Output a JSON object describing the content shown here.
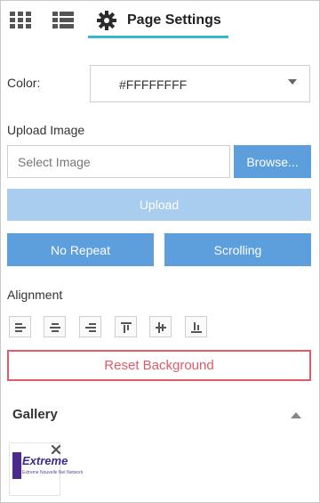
{
  "tabs": {
    "grid_icon": "grid-icon",
    "list_icon": "list-icon",
    "settings": {
      "icon": "gear-icon",
      "label": "Page Settings"
    }
  },
  "color": {
    "label": "Color:",
    "value": "#FFFFFFFF"
  },
  "upload": {
    "label": "Upload Image",
    "placeholder": "Select Image",
    "browse_label": "Browse...",
    "upload_label": "Upload"
  },
  "options": {
    "repeat_label": "No Repeat",
    "attachment_label": "Scrolling"
  },
  "alignment": {
    "label": "Alignment",
    "buttons": [
      "align-left-icon",
      "align-center-icon",
      "align-right-icon",
      "align-top-icon",
      "align-middle-icon",
      "align-bottom-icon"
    ]
  },
  "reset": {
    "label": "Reset Background"
  },
  "gallery": {
    "label": "Gallery",
    "items": [
      {
        "logo_text": "Extreme",
        "logo_subtext": "Extreme Nouvelle Net Network"
      }
    ]
  },
  "colors": {
    "accent": "#38b8c8",
    "primary_button": "#5d9fdc",
    "disabled_button": "#a9cdee",
    "danger": "#e05a6a"
  }
}
